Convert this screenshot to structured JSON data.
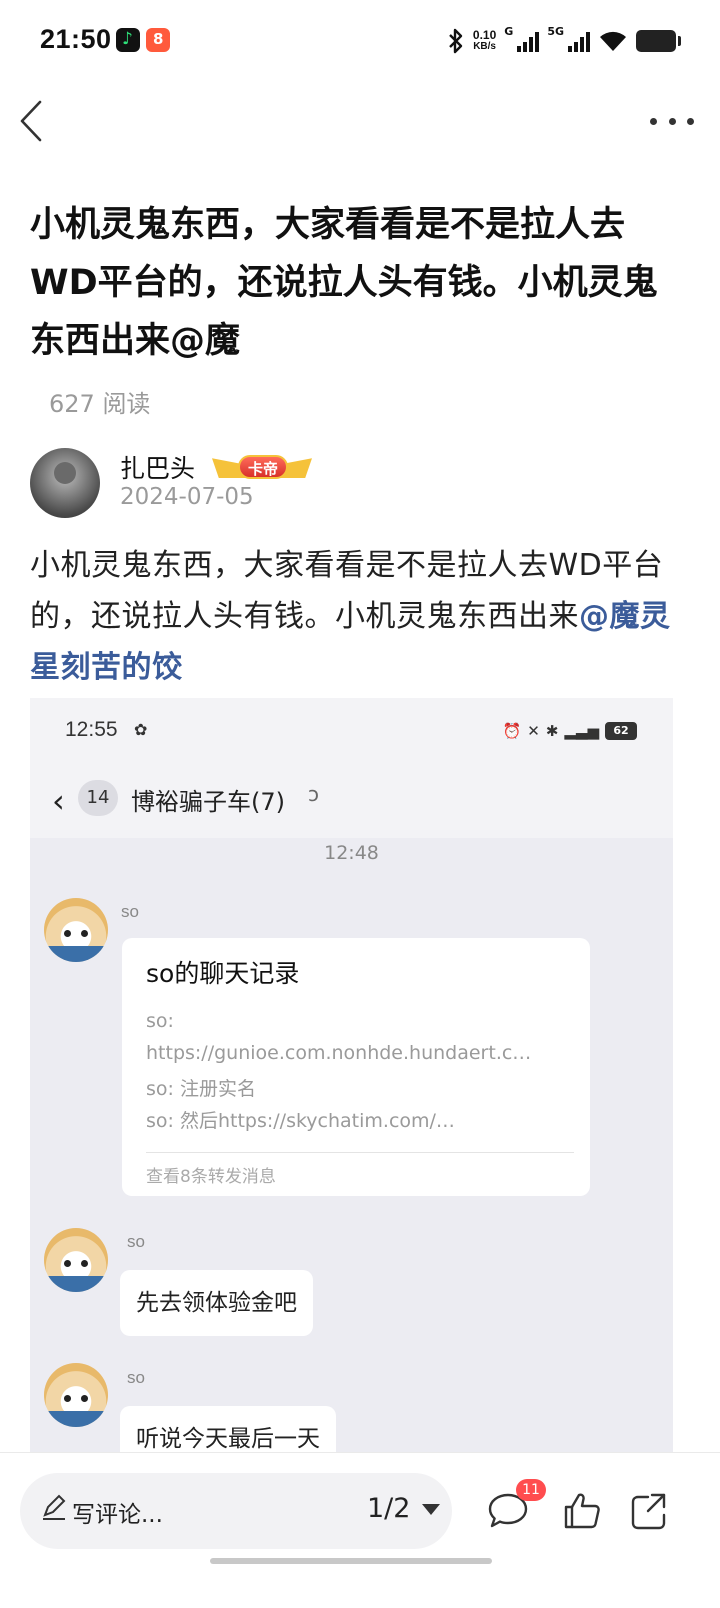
{
  "status_bar": {
    "time": "21:50",
    "net_speed_value": "0.10",
    "net_speed_unit": "KB/s",
    "net_g": "G",
    "net_5g": "5G"
  },
  "icons": {
    "back": "chevron-left-icon",
    "more": "more-dots-icon",
    "comment": "comment-bubble-icon",
    "like": "thumbs-up-icon",
    "share": "share-icon",
    "edit": "pencil-icon"
  },
  "post": {
    "title": "小机灵鬼东西，大家看看是不是拉人去WD平台的，还说拉人头有钱。小机灵鬼东西出来@魔",
    "reads": "627 阅读",
    "author": {
      "name": "扎巴头",
      "medal_label": "卡帝",
      "date": "2024-07-05"
    },
    "body_text": "小机灵鬼东西，大家看看是不是拉人去WD平台的，还说拉人头有钱。小机灵鬼东西出来",
    "mention": "@魔灵星刻苦的饺"
  },
  "screenshot": {
    "status_time": "12:55",
    "battery": "62",
    "back_count": "14",
    "chat_title": "博裕骗子车(7)",
    "chat_time": "12:48",
    "messages": [
      {
        "sender": "so",
        "card_title": "so的聊天记录",
        "card_lines": [
          "so:",
          "https://gunioe.com.nonhde.hundaert.c…",
          "so: 注册实名",
          "so: 然后https://skychatim.com/…"
        ],
        "card_footer": "查看8条转发消息"
      },
      {
        "sender": "so",
        "text": "先去领体验金吧"
      },
      {
        "sender": "so",
        "text": "听说今天最后一天"
      }
    ]
  },
  "bottom_bar": {
    "comment_placeholder": "写评论...",
    "page_indicator": "1/2",
    "comment_count": "11"
  },
  "colors": {
    "mention": "#3b5c9a",
    "badge": "#ff4d4f",
    "muted_text": "#9a9a9a",
    "chat_background": "#ececf2"
  }
}
